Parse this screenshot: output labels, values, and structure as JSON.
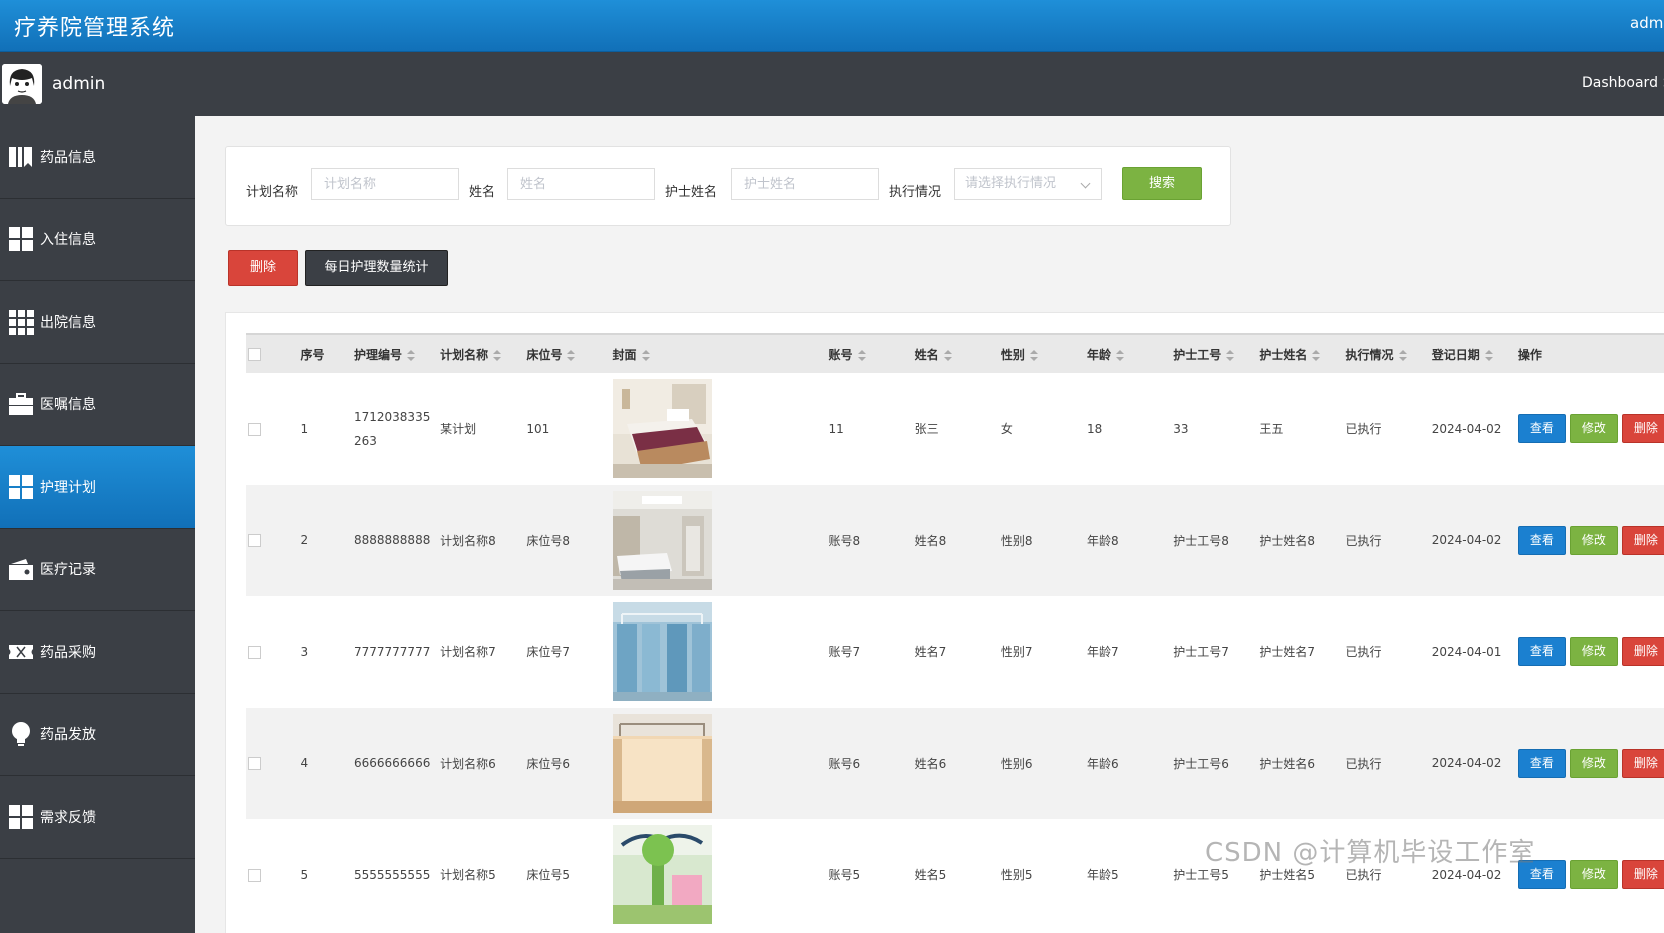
{
  "header": {
    "title": "疗养院管理系统",
    "user": "admin"
  },
  "userbar": {
    "username": "admin",
    "breadcrumb": "Dashboard >"
  },
  "sidebar": {
    "items": [
      {
        "label": "药品信息",
        "icon": "book-icon",
        "active": false
      },
      {
        "label": "入住信息",
        "icon": "grid-icon",
        "active": false
      },
      {
        "label": "出院信息",
        "icon": "grid-nine-icon",
        "active": false
      },
      {
        "label": "医嘱信息",
        "icon": "briefcase-icon",
        "active": false
      },
      {
        "label": "护理计划",
        "icon": "grid-icon",
        "active": true
      },
      {
        "label": "医疗记录",
        "icon": "wallet-icon",
        "active": false
      },
      {
        "label": "药品采购",
        "icon": "ticket-icon",
        "active": false
      },
      {
        "label": "药品发放",
        "icon": "lightbulb-icon",
        "active": false
      },
      {
        "label": "需求反馈",
        "icon": "grid-icon",
        "active": false
      }
    ]
  },
  "search": {
    "plan_label": "计划名称",
    "plan_placeholder": "计划名称",
    "name_label": "姓名",
    "name_placeholder": "姓名",
    "nurse_label": "护士姓名",
    "nurse_placeholder": "护士姓名",
    "status_label": "执行情况",
    "status_placeholder": "请选择执行情况",
    "button": "搜索"
  },
  "actions": {
    "delete": "删除",
    "stats": "每日护理数量统计"
  },
  "table": {
    "headers": {
      "seq": "序号",
      "code": "护理编号",
      "plan": "计划名称",
      "bed": "床位号",
      "cover": "封面",
      "account": "账号",
      "name": "姓名",
      "gender": "性别",
      "age": "年龄",
      "nurse_no": "护士工号",
      "nurse_name": "护士姓名",
      "status": "执行情况",
      "date": "登记日期",
      "ops": "操作"
    },
    "op_labels": {
      "view": "查看",
      "edit": "修改",
      "delete": "删除"
    },
    "rows": [
      {
        "seq": "1",
        "code": "1712038335263",
        "plan": "某计划",
        "bed": "101",
        "account": "11",
        "name": "张三",
        "gender": "女",
        "age": "18",
        "nurse_no": "33",
        "nurse_name": "王五",
        "status": "已执行",
        "date": "2024-04-02"
      },
      {
        "seq": "2",
        "code": "8888888888",
        "plan": "计划名称8",
        "bed": "床位号8",
        "account": "账号8",
        "name": "姓名8",
        "gender": "性别8",
        "age": "年龄8",
        "nurse_no": "护士工号8",
        "nurse_name": "护士姓名8",
        "status": "已执行",
        "date": "2024-04-02"
      },
      {
        "seq": "3",
        "code": "7777777777",
        "plan": "计划名称7",
        "bed": "床位号7",
        "account": "账号7",
        "name": "姓名7",
        "gender": "性别7",
        "age": "年龄7",
        "nurse_no": "护士工号7",
        "nurse_name": "护士姓名7",
        "status": "已执行",
        "date": "2024-04-01"
      },
      {
        "seq": "4",
        "code": "6666666666",
        "plan": "计划名称6",
        "bed": "床位号6",
        "account": "账号6",
        "name": "姓名6",
        "gender": "性别6",
        "age": "年龄6",
        "nurse_no": "护士工号6",
        "nurse_name": "护士姓名6",
        "status": "已执行",
        "date": "2024-04-02"
      },
      {
        "seq": "5",
        "code": "5555555555",
        "plan": "计划名称5",
        "bed": "床位号5",
        "account": "账号5",
        "name": "姓名5",
        "gender": "性别5",
        "age": "年龄5",
        "nurse_no": "护士工号5",
        "nurse_name": "护士姓名5",
        "status": "已执行",
        "date": "2024-04-02"
      }
    ]
  },
  "watermark": "CSDN @计算机毕设工作室",
  "colors": {
    "primary": "#1b80d0",
    "success": "#7cb342",
    "danger": "#d9453b",
    "sidebar": "#3b3f45"
  }
}
